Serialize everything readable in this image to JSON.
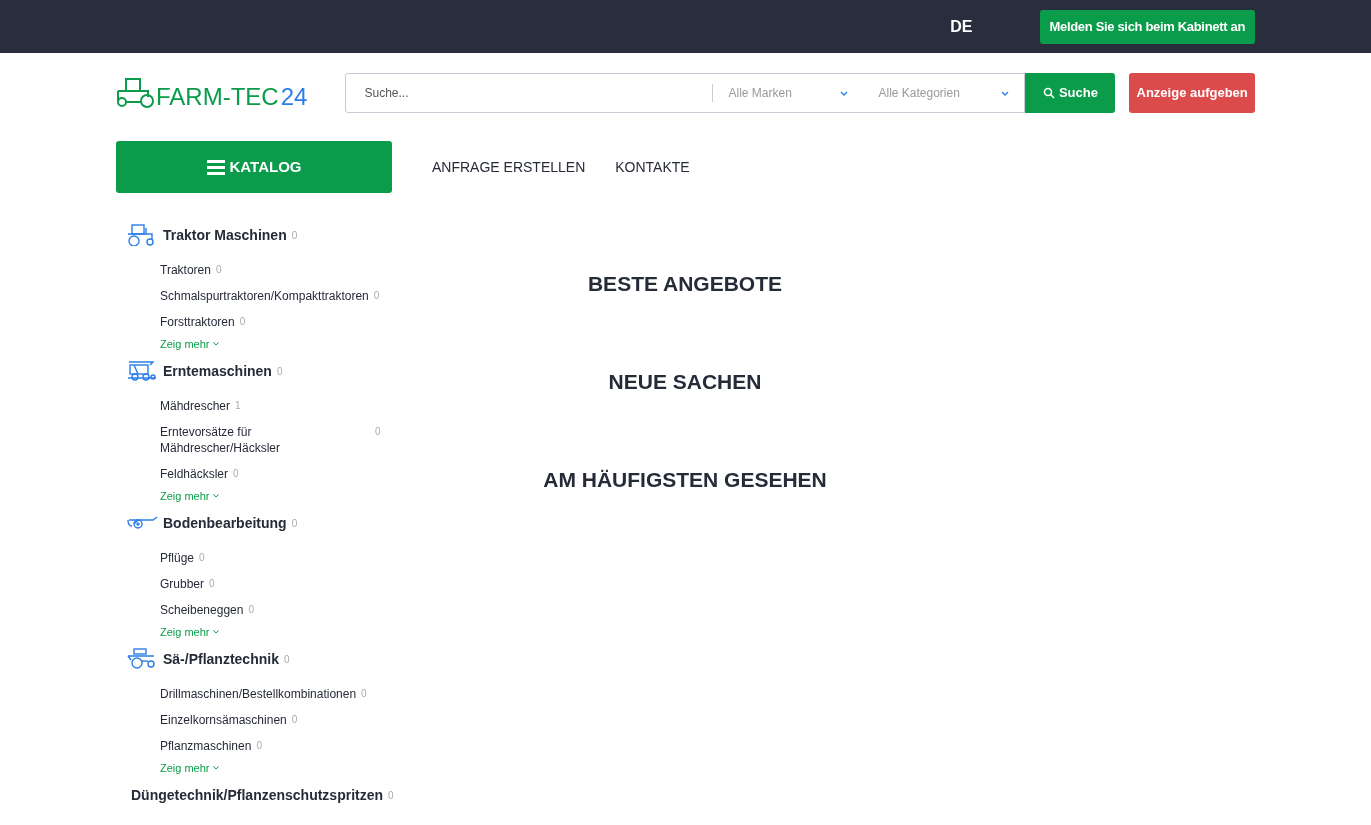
{
  "topbar": {
    "language": "DE",
    "login_button": "Melden Sie sich beim Kabinett an"
  },
  "header": {
    "logo": {
      "name": "FARM-TEC",
      "suffix": "24"
    },
    "search": {
      "placeholder": "Suche..."
    },
    "brand_select": "Alle Marken",
    "category_select": "Alle Kategorien",
    "search_button": "Suche",
    "post_ad_button": "Anzeige aufgeben"
  },
  "nav": {
    "catalog_button": "KATALOG",
    "links": [
      "ANFRAGE ERSTELLEN",
      "KONTAKTE"
    ]
  },
  "categories": [
    {
      "kind": "tractor",
      "name": "Traktor Maschinen",
      "count": "0",
      "items": [
        {
          "name": "Traktoren",
          "count": "0"
        },
        {
          "name": "Schmalspurtraktoren/Kompakttraktoren",
          "count": "0"
        },
        {
          "name": "Forsttraktoren",
          "count": "0"
        }
      ],
      "more": "Zeig mehr"
    },
    {
      "kind": "harvester",
      "name": "Erntemaschinen",
      "count": "0",
      "items": [
        {
          "name": "Mähdrescher",
          "count": "1"
        },
        {
          "name": "Erntevorsätze für Mähdrescher/Häcksler",
          "count": "0"
        },
        {
          "name": "Feldhäcksler",
          "count": "0"
        }
      ],
      "more": "Zeig mehr"
    },
    {
      "kind": "plough",
      "name": "Bodenbearbeitung",
      "count": "0",
      "items": [
        {
          "name": "Pflüge",
          "count": "0"
        },
        {
          "name": "Grubber",
          "count": "0"
        },
        {
          "name": "Scheibeneggen",
          "count": "0"
        }
      ],
      "more": "Zeig mehr"
    },
    {
      "kind": "seeder",
      "name": "Sä-/Pflanztechnik",
      "count": "0",
      "items": [
        {
          "name": "Drillmaschinen/Bestellkombinationen",
          "count": "0"
        },
        {
          "name": "Einzelkornsämaschinen",
          "count": "0"
        },
        {
          "name": "Pflanzmaschinen",
          "count": "0"
        }
      ],
      "more": "Zeig mehr"
    },
    {
      "kind": "sprayer",
      "name": "Düngetechnik/Pflanzenschutzspritzen",
      "count": "0"
    }
  ],
  "sections": [
    "BESTE ANGEBOTE",
    "NEUE SACHEN",
    "AM HÄUFIGSTEN GESEHEN"
  ]
}
